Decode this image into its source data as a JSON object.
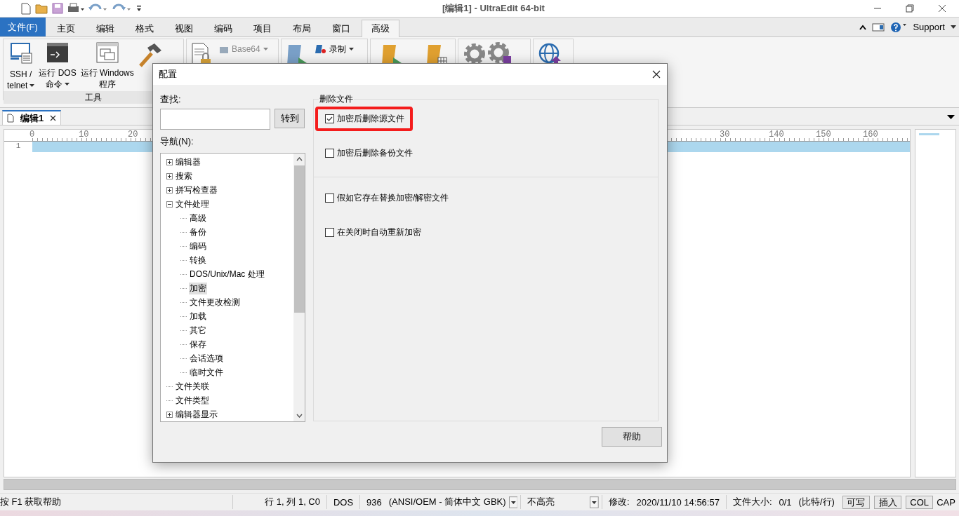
{
  "window": {
    "title": "[编辑1] - UltraEdit 64-bit"
  },
  "ribbon": {
    "file_tab": "文件(F)",
    "tabs": [
      {
        "label": "主页",
        "selected": false
      },
      {
        "label": "编辑",
        "selected": false
      },
      {
        "label": "格式",
        "selected": false
      },
      {
        "label": "视图",
        "selected": false
      },
      {
        "label": "编码",
        "selected": false
      },
      {
        "label": "项目",
        "selected": false
      },
      {
        "label": "布局",
        "selected": false
      },
      {
        "label": "窗口",
        "selected": false
      },
      {
        "label": "高级",
        "selected": true
      }
    ],
    "support": "Support",
    "tools_group": {
      "label": "工具",
      "buttons": [
        {
          "line1": "SSH /",
          "line2": "telnet",
          "dropdown": true
        },
        {
          "line1": "运行 DOS",
          "line2": "命令",
          "dropdown": true
        },
        {
          "line1": "运行 Windows",
          "line2": "程序",
          "dropdown": false
        }
      ]
    },
    "small_buttons": [
      {
        "label": "Base64",
        "disabled": true
      },
      {
        "label": "录制",
        "disabled": false
      }
    ]
  },
  "document_tab": {
    "label": "编辑1"
  },
  "ruler": [
    "0",
    "10",
    "20",
    "30",
    "140",
    "150",
    "160"
  ],
  "editor": {
    "line_numbers": [
      "1"
    ]
  },
  "dialog": {
    "title": "配置",
    "find_label": "查找:",
    "find_button": "转到",
    "nav_label": "导航(N):",
    "tree": [
      {
        "label": "编辑器",
        "expanded": false,
        "selected": false
      },
      {
        "label": "搜索",
        "expanded": false,
        "selected": false
      },
      {
        "label": "拼写检查器",
        "expanded": false,
        "selected": false
      },
      {
        "label": "文件处理",
        "expanded": true,
        "selected": false,
        "children": [
          {
            "label": "高级",
            "selected": false
          },
          {
            "label": "备份",
            "selected": false
          },
          {
            "label": "编码",
            "selected": false
          },
          {
            "label": "转换",
            "selected": false
          },
          {
            "label": "DOS/Unix/Mac 处理",
            "selected": false
          },
          {
            "label": "加密",
            "selected": true
          },
          {
            "label": "文件更改检测",
            "selected": false
          },
          {
            "label": "加载",
            "selected": false
          },
          {
            "label": "其它",
            "selected": false
          },
          {
            "label": "保存",
            "selected": false
          },
          {
            "label": "会话选项",
            "selected": false
          },
          {
            "label": "临时文件",
            "selected": false
          }
        ]
      },
      {
        "label": "文件关联",
        "selected": false
      },
      {
        "label": "文件类型",
        "selected": false
      },
      {
        "label": "编辑器显示",
        "expanded": false,
        "selected": false
      }
    ],
    "group_title": "删除文件",
    "options": [
      {
        "label": "加密后删除源文件",
        "checked": true,
        "highlighted": true
      },
      {
        "label": "加密后删除备份文件",
        "checked": false,
        "highlighted": false
      },
      {
        "label": "假如它存在替换加密/解密文件",
        "checked": false,
        "highlighted": false
      },
      {
        "label": "在关闭时自动重新加密",
        "checked": false,
        "highlighted": false
      }
    ],
    "help_button": "帮助"
  },
  "status_bar": {
    "hint": "按 F1 获取帮助",
    "position": "行 1, 列 1, C0",
    "line_ending": "DOS",
    "codepage": "936",
    "encoding": "(ANSI/OEM - 简体中文 GBK)",
    "highlight": "不高亮",
    "modified_label": "修改:",
    "modified": "2020/11/10 14:56:57",
    "size_label": "文件大小:",
    "size": "0/1",
    "size_unit": "(比特/行)",
    "buttons": [
      {
        "label": "可写"
      },
      {
        "label": "插入"
      },
      {
        "label": "COL"
      }
    ],
    "caps": "CAP"
  }
}
